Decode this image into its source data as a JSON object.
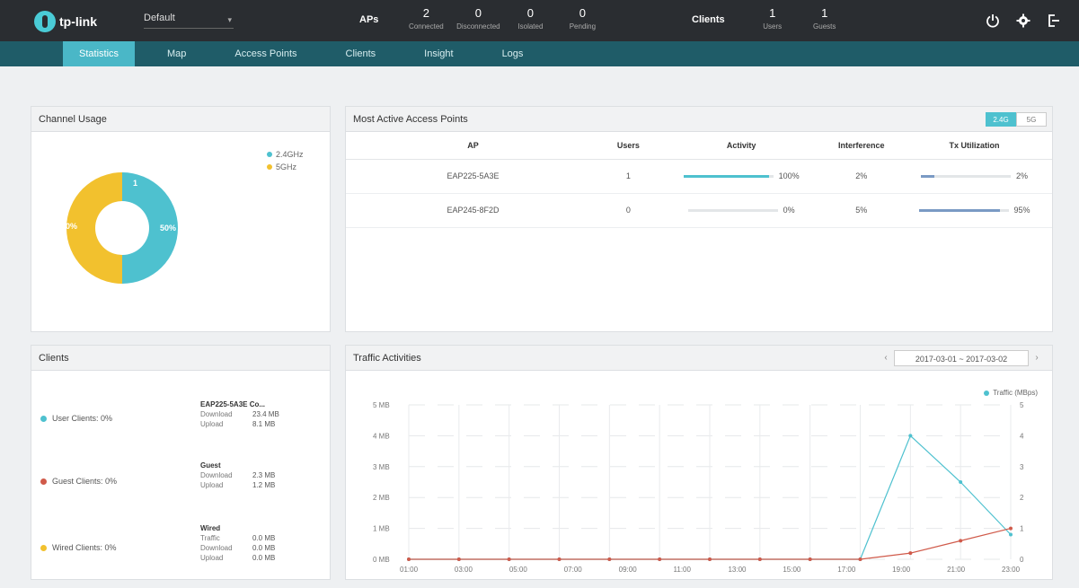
{
  "app": {
    "logo_text": "tp-link",
    "site": "Default",
    "site_caret": "▾"
  },
  "top_stats": {
    "group1": {
      "label": "APs",
      "items": [
        {
          "num": "2",
          "label": "Connected"
        },
        {
          "num": "0",
          "label": "Disconnected"
        },
        {
          "num": "0",
          "label": "Isolated"
        },
        {
          "num": "0",
          "label": "Pending"
        }
      ]
    },
    "group2": {
      "label": "Clients",
      "items": [
        {
          "num": "1",
          "label": "Users"
        },
        {
          "num": "1",
          "label": "Guests"
        }
      ]
    }
  },
  "top_icons": [
    "power-icon",
    "gear-icon",
    "logout-icon"
  ],
  "nav": {
    "tabs": [
      "Statistics",
      "Map",
      "Access Points",
      "Clients",
      "Insight",
      "Logs"
    ],
    "active": 0
  },
  "channel_panel": {
    "title": "Channel Usage",
    "legend": [
      {
        "label": "2.4GHz",
        "color": "#4ec1cf"
      },
      {
        "label": "5GHz",
        "color": "#f2c12e"
      }
    ],
    "slices": [
      {
        "label": "50%",
        "value": 50,
        "color": "#4ec1cf"
      },
      {
        "label": "50%",
        "value": 50,
        "color": "#f2c12e"
      }
    ],
    "top_label": "1"
  },
  "ap_panel": {
    "title": "Most Active Access Points",
    "toggle": [
      "2.4G",
      "5G"
    ],
    "columns": [
      "AP",
      "Users",
      "Activity",
      "Interference",
      "Tx Utilization"
    ],
    "rows": [
      {
        "ap": "EAP225-5A3E",
        "users": "1",
        "activity": "100%",
        "activity_pct": 0.95,
        "interference": "2%",
        "tx": "2%",
        "tx_pct": 0.15
      },
      {
        "ap": "EAP245-8F2D",
        "users": "0",
        "activity": "0%",
        "activity_pct": 0.0,
        "interference": "5%",
        "tx": "95%",
        "tx_pct": 0.9
      }
    ]
  },
  "clients_panel": {
    "title": "Clients",
    "items": [
      {
        "label": "User Clients: 0%",
        "color": "#4ec1cf",
        "detail_title": "EAP225-5A3E Co...",
        "lines": [
          [
            "Download",
            "23.4 MB"
          ],
          [
            "Upload",
            "8.1 MB"
          ]
        ]
      },
      {
        "label": "Guest Clients: 0%",
        "color": "#d05a4a",
        "detail_title": "Guest",
        "lines": [
          [
            "Download",
            "2.3 MB"
          ],
          [
            "Upload",
            "1.2 MB"
          ]
        ]
      },
      {
        "label": "Wired Clients: 0%",
        "color": "#f2c12e",
        "detail_title": "Wired",
        "lines": [
          [
            "Traffic",
            "0.0 MB"
          ],
          [
            "Download",
            "0.0 MB"
          ],
          [
            "Upload",
            "0.0 MB"
          ]
        ]
      }
    ]
  },
  "traffic_panel": {
    "title": "Traffic Activities",
    "date_range": "2017-03-01 ~ 2017-03-02",
    "legend_label": "Traffic (MBps)"
  },
  "chart_data": {
    "type": "line",
    "x": [
      "01:00",
      "03:00",
      "05:00",
      "07:00",
      "09:00",
      "11:00",
      "13:00",
      "15:00",
      "17:00",
      "19:00",
      "21:00",
      "23:00"
    ],
    "y_ticks_left": [
      "0 MB",
      "1 MB",
      "2 MB",
      "3 MB",
      "4 MB",
      "5 MB"
    ],
    "y_ticks_right": [
      "0",
      "1",
      "2",
      "3",
      "4",
      "5"
    ],
    "ylim": [
      0,
      5
    ],
    "series": [
      {
        "color": "#4ec1cf",
        "values": [
          0,
          0,
          0,
          0,
          0,
          0,
          0,
          0,
          0,
          0,
          4.0,
          2.5,
          0.8
        ]
      },
      {
        "color": "#d05a4a",
        "values": [
          0,
          0,
          0,
          0,
          0,
          0,
          0,
          0,
          0,
          0,
          0.2,
          0.6,
          1.0
        ]
      }
    ],
    "grid": true
  }
}
